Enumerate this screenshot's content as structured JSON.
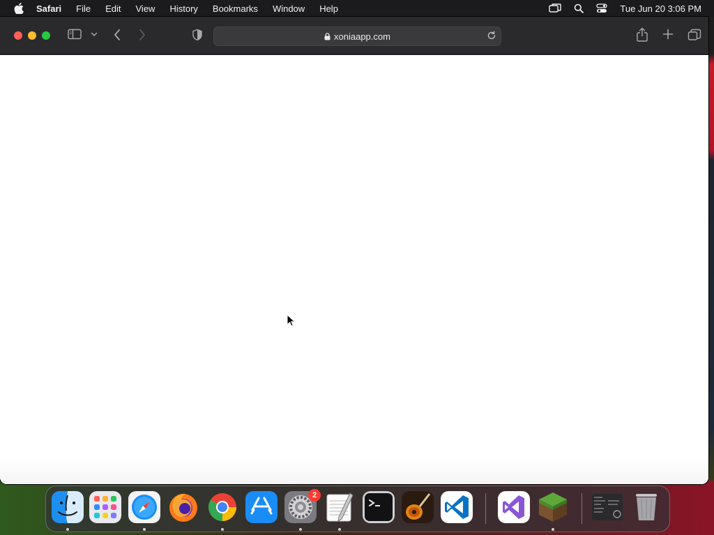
{
  "menubar": {
    "app_name": "Safari",
    "items": [
      "File",
      "Edit",
      "View",
      "History",
      "Bookmarks",
      "Window",
      "Help"
    ],
    "clock": "Tue Jun 20  3:06 PM",
    "icons": [
      "apple-logo-icon",
      "screen-mirroring-icon",
      "spotlight-search-icon",
      "control-center-icon"
    ]
  },
  "browser": {
    "url": "xoniaapp.com",
    "toolbar_icons": [
      "sidebar-icon",
      "chevron-down-icon",
      "back-icon",
      "forward-icon",
      "privacy-shield-icon",
      "lock-icon",
      "reload-icon",
      "share-icon",
      "new-tab-icon",
      "tab-overview-icon"
    ]
  },
  "dock": {
    "apps": [
      {
        "name": "Finder",
        "running": true
      },
      {
        "name": "Launchpad",
        "running": false
      },
      {
        "name": "Safari",
        "running": true
      },
      {
        "name": "Firefox",
        "running": false
      },
      {
        "name": "Google Chrome",
        "running": true
      },
      {
        "name": "App Store",
        "running": false
      },
      {
        "name": "System Settings",
        "running": true,
        "badge": "2"
      },
      {
        "name": "TextEdit",
        "running": true
      },
      {
        "name": "Terminal",
        "running": false
      },
      {
        "name": "GarageBand",
        "running": false
      },
      {
        "name": "Visual Studio Code",
        "running": false
      },
      {
        "name": "Visual Studio",
        "running": false
      },
      {
        "name": "Minecraft",
        "running": true
      },
      {
        "name": "Screenshot Window",
        "running": false
      },
      {
        "name": "Trash",
        "running": false
      }
    ]
  },
  "colors": {
    "close": "#fe5f57",
    "minimize": "#febc2e",
    "maximize": "#28c840",
    "badge": "#ff3b30"
  }
}
